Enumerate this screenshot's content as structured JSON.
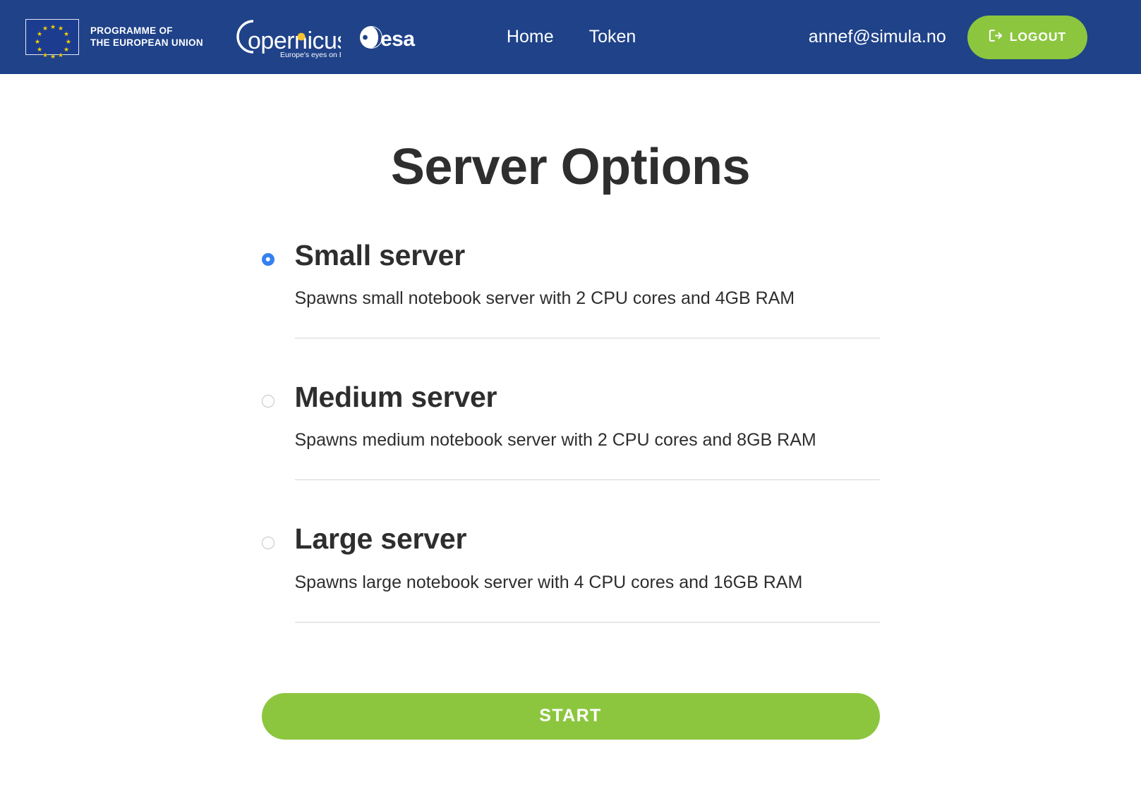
{
  "header": {
    "background_color": "#1f4289",
    "eu_logo": {
      "icon": "eu-flag-icon",
      "line1": "PROGRAMME OF",
      "line2": "THE EUROPEAN UNION"
    },
    "copernicus_logo": {
      "icon": "copernicus-logo-icon",
      "wordmark": "opernicus",
      "initial": "C",
      "tagline": "Europe's eyes on Earth"
    },
    "esa_logo": {
      "icon": "esa-logo-icon",
      "wordmark": "esa"
    },
    "nav": [
      {
        "label": "Home",
        "name": "nav-link-home"
      },
      {
        "label": "Token",
        "name": "nav-link-token"
      }
    ],
    "user_email": "annef@simula.no",
    "logout": {
      "label": "LOGOUT",
      "icon": "sign-out-icon",
      "color": "#8cc63f"
    }
  },
  "main": {
    "title": "Server Options",
    "options": [
      {
        "label": "Small server",
        "description": "Spawns small notebook server with 2 CPU cores and 4GB RAM",
        "selected": true,
        "value": "small"
      },
      {
        "label": "Medium server",
        "description": "Spawns medium notebook server with 2 CPU cores and 8GB RAM",
        "selected": false,
        "value": "medium"
      },
      {
        "label": "Large server",
        "description": "Spawns large notebook server with 4 CPU cores and 16GB RAM",
        "selected": false,
        "value": "large"
      }
    ],
    "start_button": {
      "label": "START",
      "color": "#8cc63f"
    }
  },
  "colors": {
    "header_blue": "#1f4289",
    "accent_green": "#8cc63f",
    "radio_blue": "#3581f0",
    "text_dark": "#2e2e2e",
    "divider": "#d4d4d6"
  }
}
